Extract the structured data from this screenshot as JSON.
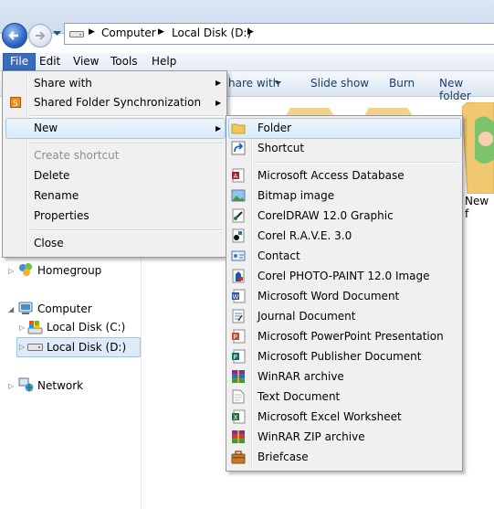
{
  "address": {
    "crumbs": [
      "Computer",
      "Local Disk (D:)"
    ]
  },
  "menubar": [
    "File",
    "Edit",
    "View",
    "Tools",
    "Help"
  ],
  "toolbar": {
    "share_with": "hare with",
    "slide_show": "Slide show",
    "burn": "Burn",
    "new_folder": "New folder"
  },
  "content": {
    "partial_item_label": "New f"
  },
  "navpane": {
    "homegroup": "Homegroup",
    "computer": "Computer",
    "local_c": "Local Disk (C:)",
    "local_d": "Local Disk (D:)",
    "network": "Network"
  },
  "file_menu": {
    "share_with": "Share with",
    "shared_sync": "Shared Folder Synchronization",
    "new": "New",
    "create_shortcut": "Create shortcut",
    "delete": "Delete",
    "rename": "Rename",
    "properties": "Properties",
    "close": "Close"
  },
  "new_menu": {
    "items": [
      {
        "label": "Folder",
        "icon": "folder-icon"
      },
      {
        "label": "Shortcut",
        "icon": "shortcut-icon"
      },
      {
        "label": "Microsoft Access Database",
        "icon": "access-icon"
      },
      {
        "label": "Bitmap image",
        "icon": "bitmap-icon"
      },
      {
        "label": "CorelDRAW 12.0 Graphic",
        "icon": "coreldraw-icon"
      },
      {
        "label": "Corel R.A.V.E. 3.0",
        "icon": "corel-rave-icon"
      },
      {
        "label": "Contact",
        "icon": "contact-icon"
      },
      {
        "label": "Corel PHOTO-PAINT 12.0 Image",
        "icon": "photopaint-icon"
      },
      {
        "label": "Microsoft Word Document",
        "icon": "word-icon"
      },
      {
        "label": "Journal Document",
        "icon": "journal-icon"
      },
      {
        "label": "Microsoft PowerPoint Presentation",
        "icon": "powerpoint-icon"
      },
      {
        "label": "Microsoft Publisher Document",
        "icon": "publisher-icon"
      },
      {
        "label": "WinRAR archive",
        "icon": "winrar-icon"
      },
      {
        "label": "Text Document",
        "icon": "text-document-icon"
      },
      {
        "label": "Microsoft Excel Worksheet",
        "icon": "excel-icon"
      },
      {
        "label": "WinRAR ZIP archive",
        "icon": "winrar-zip-icon"
      },
      {
        "label": "Briefcase",
        "icon": "briefcase-icon"
      }
    ]
  }
}
